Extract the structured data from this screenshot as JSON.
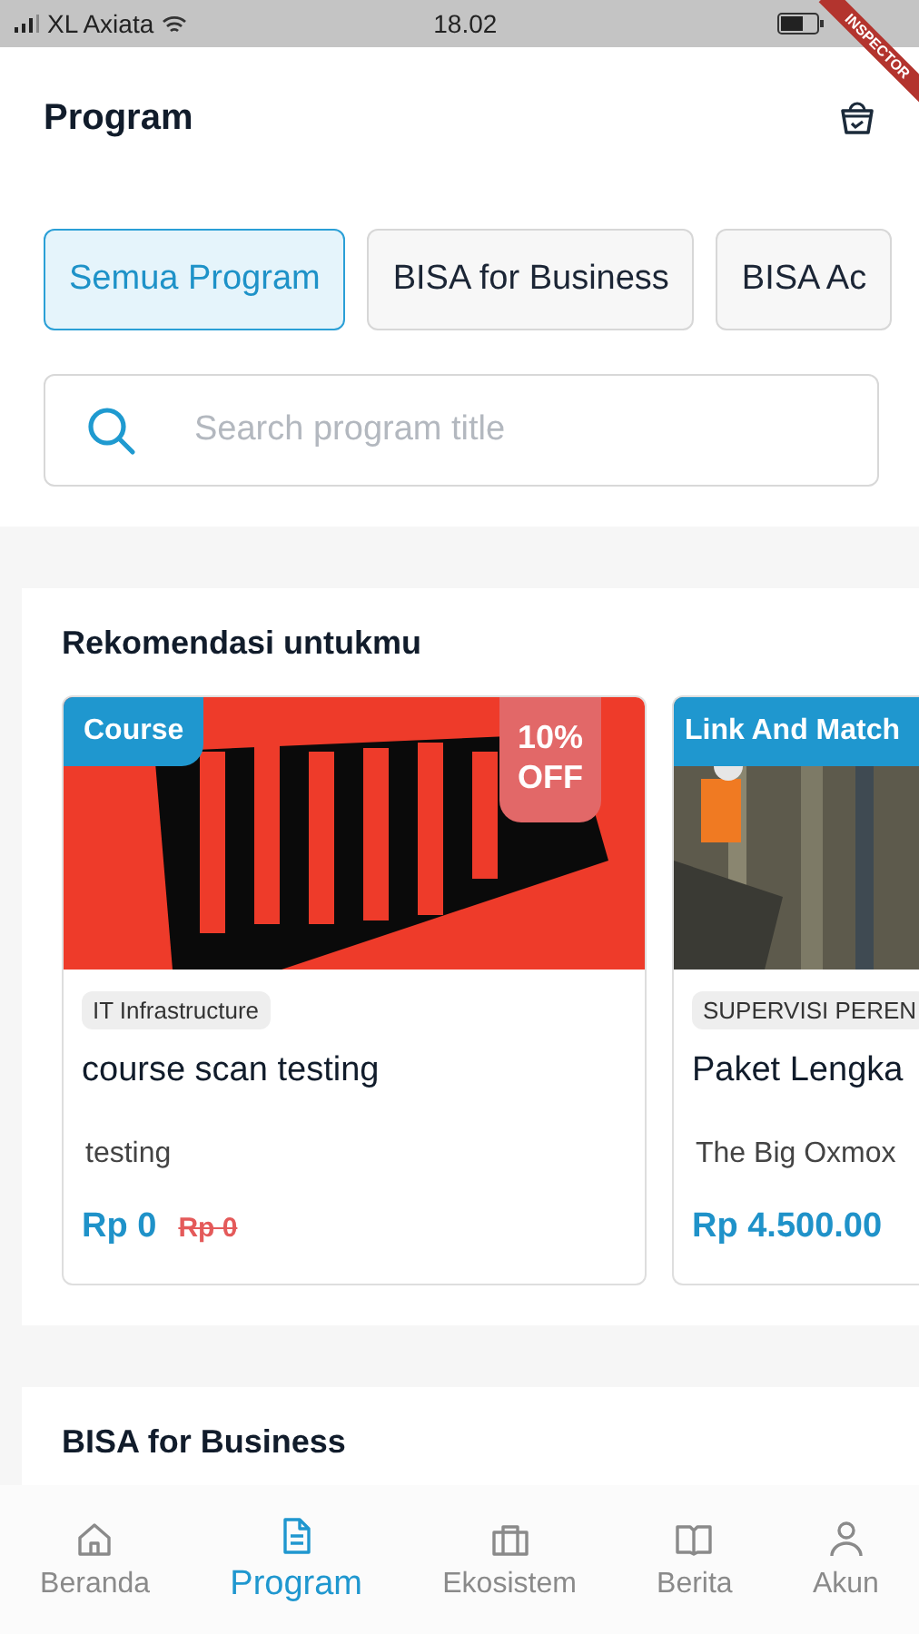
{
  "status_bar": {
    "carrier": "XL Axiata",
    "time": "18.02"
  },
  "debug_banner": "INSPECTOR",
  "header": {
    "title": "Program"
  },
  "tabs": [
    {
      "label": "Semua Program",
      "selected": true
    },
    {
      "label": "BISA for Business",
      "selected": false
    },
    {
      "label": "BISA Ac",
      "selected": false
    }
  ],
  "search": {
    "placeholder": "Search program title"
  },
  "sections": [
    {
      "title": "Rekomendasi untukmu",
      "cards": [
        {
          "type": "Course",
          "discount": [
            "10%",
            "OFF"
          ],
          "category": "IT Infrastructure",
          "title": "course scan testing",
          "description": "testing",
          "price": "Rp 0",
          "old_price": "Rp 0"
        },
        {
          "type": "Link And Match",
          "category": "SUPERVISI PEREN",
          "title": "Paket Lengka",
          "description": "The Big Oxmox",
          "price": "Rp 4.500.00"
        }
      ]
    },
    {
      "title": "BISA for Business"
    }
  ],
  "bottom_nav": [
    {
      "label": "Beranda",
      "selected": false
    },
    {
      "label": "Program",
      "selected": true
    },
    {
      "label": "Ekosistem",
      "selected": false
    },
    {
      "label": "Berita",
      "selected": false
    },
    {
      "label": "Akun",
      "selected": false
    }
  ]
}
